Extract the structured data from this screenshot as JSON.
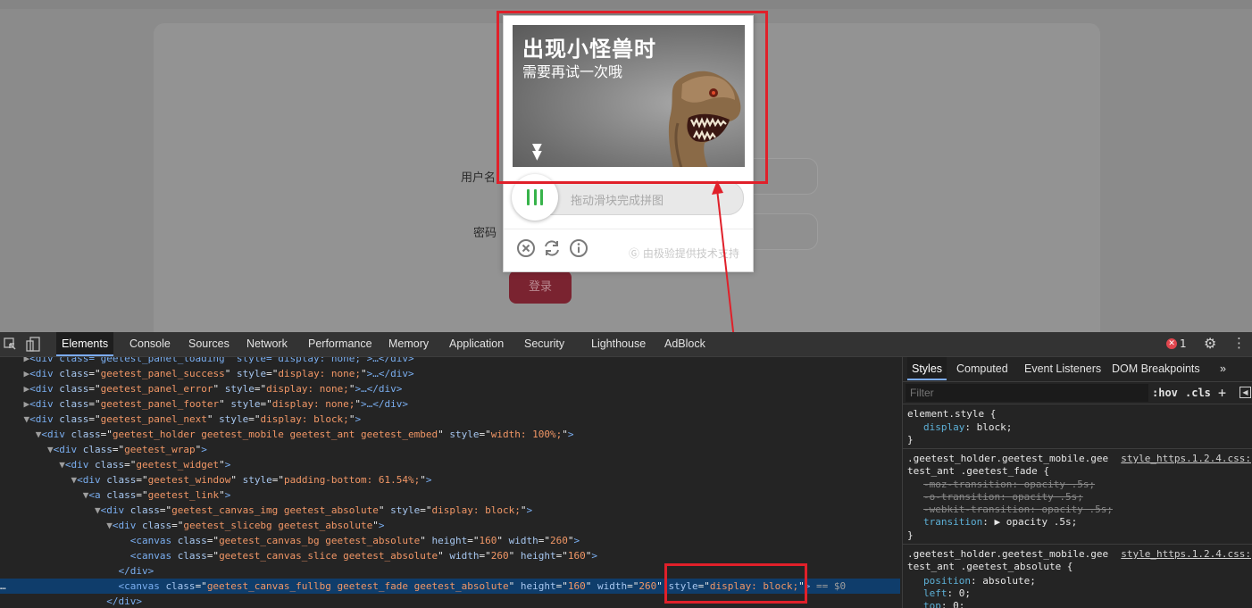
{
  "login": {
    "username_label": "用户名",
    "password_label": "密码",
    "submit_label": "登录"
  },
  "captcha": {
    "title": "出现小怪兽时",
    "subtitle": "需要再试一次哦",
    "slider_hint": "拖动滑块完成拼图",
    "credit": "由极验提供技术支持",
    "icons": [
      "close-icon",
      "refresh-icon",
      "info-icon"
    ]
  },
  "devtools": {
    "tabs": [
      "Elements",
      "Console",
      "Sources",
      "Network",
      "Performance",
      "Memory",
      "Application",
      "Security",
      "Lighthouse",
      "AdBlock"
    ],
    "active_tab": "Elements",
    "error_count": "1",
    "dom_lines": [
      {
        "indent": "    ",
        "tw": "▶",
        "html": "<div class=\"geetest_panel_loading\" style=\"display: none;\">…</div>"
      },
      {
        "indent": "    ",
        "tw": "▶",
        "tag": "div",
        "attrs": [
          [
            "class",
            "geetest_panel_success"
          ],
          [
            "style",
            "display: none;"
          ]
        ],
        "tail": "…</div>"
      },
      {
        "indent": "    ",
        "tw": "▶",
        "tag": "div",
        "attrs": [
          [
            "class",
            "geetest_panel_error"
          ],
          [
            "style",
            "display: none;"
          ]
        ],
        "tail": "…</div>"
      },
      {
        "indent": "    ",
        "tw": "▶",
        "tag": "div",
        "attrs": [
          [
            "class",
            "geetest_panel_footer"
          ],
          [
            "style",
            "display: none;"
          ]
        ],
        "tail": "…</div>"
      },
      {
        "indent": "    ",
        "tw": "▼",
        "tag": "div",
        "attrs": [
          [
            "class",
            "geetest_panel_next"
          ],
          [
            "style",
            "display: block;"
          ]
        ],
        "tail": ""
      },
      {
        "indent": "      ",
        "tw": "▼",
        "tag": "div",
        "attrs": [
          [
            "class",
            "geetest_holder geetest_mobile geetest_ant geetest_embed"
          ],
          [
            "style",
            "width: 100%;"
          ]
        ],
        "tail": ""
      },
      {
        "indent": "        ",
        "tw": "▼",
        "tag": "div",
        "attrs": [
          [
            "class",
            "geetest_wrap"
          ]
        ],
        "tail": ""
      },
      {
        "indent": "          ",
        "tw": "▼",
        "tag": "div",
        "attrs": [
          [
            "class",
            "geetest_widget"
          ]
        ],
        "tail": ""
      },
      {
        "indent": "            ",
        "tw": "▼",
        "tag": "div",
        "attrs": [
          [
            "class",
            "geetest_window"
          ],
          [
            "style",
            "padding-bottom: 61.54%;"
          ]
        ],
        "tail": ""
      },
      {
        "indent": "              ",
        "tw": "▼",
        "tag": "a",
        "attrs": [
          [
            "class",
            "geetest_link"
          ]
        ],
        "tail": ""
      },
      {
        "indent": "                ",
        "tw": "▼",
        "tag": "div",
        "attrs": [
          [
            "class",
            "geetest_canvas_img geetest_absolute"
          ],
          [
            "style",
            "display: block;"
          ]
        ],
        "tail": ""
      },
      {
        "indent": "                  ",
        "tw": "▼",
        "tag": "div",
        "attrs": [
          [
            "class",
            "geetest_slicebg geetest_absolute"
          ]
        ],
        "tail": ""
      },
      {
        "indent": "                      ",
        "tw": "",
        "tag": "canvas",
        "attrs": [
          [
            "class",
            "geetest_canvas_bg geetest_absolute"
          ],
          [
            "height",
            "160"
          ],
          [
            "width",
            "260"
          ]
        ],
        "tail": ""
      },
      {
        "indent": "                      ",
        "tw": "",
        "tag": "canvas",
        "attrs": [
          [
            "class",
            "geetest_canvas_slice geetest_absolute"
          ],
          [
            "width",
            "260"
          ],
          [
            "height",
            "160"
          ]
        ],
        "tail": ""
      },
      {
        "indent": "                    ",
        "tw": "",
        "close": "div"
      },
      {
        "indent": "                    ",
        "tw": "",
        "tag": "canvas",
        "attrs": [
          [
            "class",
            "geetest_canvas_fullbg geetest_fade geetest_absolute"
          ],
          [
            "height",
            "160"
          ],
          [
            "width",
            "260"
          ],
          [
            "style",
            "display: block;"
          ]
        ],
        "tail": " == $0",
        "selected": true
      },
      {
        "indent": "                  ",
        "tw": "",
        "close": "div"
      }
    ],
    "styles_tabs": [
      "Styles",
      "Computed",
      "Event Listeners",
      "DOM Breakpoints"
    ],
    "filter_placeholder": "Filter",
    "filter_buttons": [
      ":hov",
      ".cls",
      "+"
    ],
    "rules": {
      "element_style": {
        "selector": "element.style {",
        "prop": "display",
        "value": "block;"
      },
      "rule1": {
        "selector_l1": ".geetest_holder.geetest_mobile.gee",
        "selector_l2": "test_ant .geetest_fade {",
        "source": "style_https.1.2.4.css:",
        "decls": [
          {
            "prop": "-moz-transition",
            "value": "opacity .5s;",
            "struck": true
          },
          {
            "prop": "-o-transition",
            "value": "opacity .5s;",
            "struck": true
          },
          {
            "prop": "-webkit-transition",
            "value": "opacity .5s;",
            "struck": true
          },
          {
            "prop": "transition",
            "value": "▶ opacity .5s;",
            "struck": false
          }
        ]
      },
      "rule2": {
        "selector_l1": ".geetest_holder.geetest_mobile.gee",
        "selector_l2": "test_ant .geetest_absolute {",
        "source": "style_https.1.2.4.css:",
        "decls": [
          {
            "prop": "position",
            "value": "absolute;"
          },
          {
            "prop": "left",
            "value": "0;"
          },
          {
            "prop": "top",
            "value": "0;"
          }
        ]
      }
    }
  },
  "colors": {
    "highlight_red": "#e0202a",
    "slider_green": "#37b34a"
  }
}
